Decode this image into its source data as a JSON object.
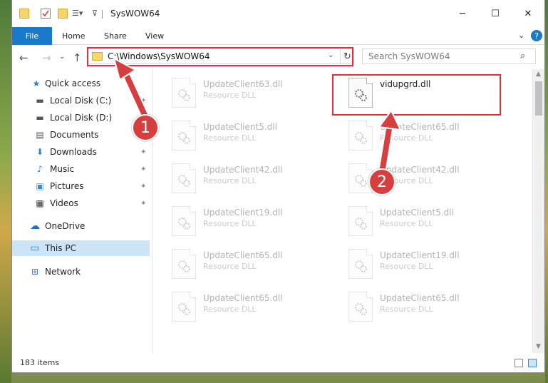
{
  "window": {
    "title": "SysWOW64",
    "controls": {
      "minimize": "─",
      "maximize": "☐",
      "close": "✕"
    }
  },
  "ribbon": {
    "file": "File",
    "tabs": [
      "Home",
      "Share",
      "View"
    ],
    "expand": "⌄",
    "help": "?"
  },
  "nav": {
    "back": "←",
    "forward": "→",
    "recent": "⌄",
    "up": "↑",
    "address": "C:\\Windows\\SysWOW64",
    "address_dropdown": "⌄",
    "refresh": "↻",
    "search_placeholder": "Search SysWOW64",
    "search_icon": "⌕"
  },
  "sidebar": {
    "items": [
      {
        "label": "Quick access",
        "icon": "star-icon",
        "glyph": "★",
        "pinned": false
      },
      {
        "label": "Local Disk (C:)",
        "icon": "drive-icon",
        "glyph": "▬",
        "pinned": true
      },
      {
        "label": "Local Disk (D:)",
        "icon": "drive-icon",
        "glyph": "▬",
        "pinned": false
      },
      {
        "label": "Documents",
        "icon": "documents-icon",
        "glyph": "▤",
        "pinned": false
      },
      {
        "label": "Downloads",
        "icon": "download-icon",
        "glyph": "⬇",
        "pinned": true
      },
      {
        "label": "Music",
        "icon": "music-icon",
        "glyph": "♪",
        "pinned": true
      },
      {
        "label": "Pictures",
        "icon": "pictures-icon",
        "glyph": "▣",
        "pinned": true
      },
      {
        "label": "Videos",
        "icon": "videos-icon",
        "glyph": "▦",
        "pinned": true
      },
      {
        "label": "OneDrive",
        "icon": "cloud-icon",
        "glyph": "☁",
        "pinned": false
      },
      {
        "label": "This PC",
        "icon": "computer-icon",
        "glyph": "▭",
        "pinned": false
      },
      {
        "label": "Network",
        "icon": "network-icon",
        "glyph": "⊞",
        "pinned": false
      }
    ],
    "pin_glyph": "📌"
  },
  "files": [
    {
      "name": "UpdateClient63.dll",
      "type": "Resource DLL"
    },
    {
      "name": "vidupgrd.dll",
      "type": ""
    },
    {
      "name": "UpdateClient5.dll",
      "type": "Resource DLL"
    },
    {
      "name": "UpdateClient65.dll",
      "type": "Resource DLL"
    },
    {
      "name": "UpdateClient42.dll",
      "type": "Resource DLL"
    },
    {
      "name": "UpdateClient42.dll",
      "type": "Resource DLL"
    },
    {
      "name": "UpdateClient19.dll",
      "type": "Resource DLL"
    },
    {
      "name": "UpdateClient5.dll",
      "type": "Resource DLL"
    },
    {
      "name": "UpdateClient65.dll",
      "type": "Resource DLL"
    },
    {
      "name": "UpdateClient19.dll",
      "type": "Resource DLL"
    },
    {
      "name": "UpdateClient65.dll",
      "type": "Resource DLL"
    },
    {
      "name": "UpdateClient65.dll",
      "type": "Resource DLL"
    }
  ],
  "status": {
    "item_count": "183 items"
  },
  "annotations": {
    "step1": "1",
    "step2": "2",
    "color": "#d63f3f"
  }
}
